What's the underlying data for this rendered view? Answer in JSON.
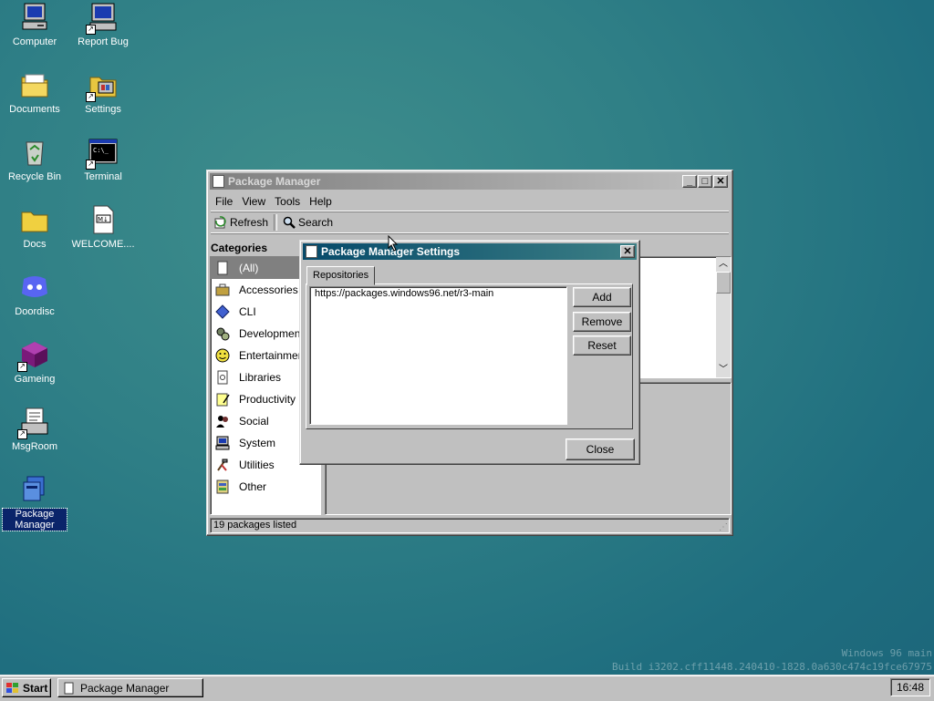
{
  "desktop": {
    "icons": [
      {
        "label": "Computer"
      },
      {
        "label": "Report Bug"
      },
      {
        "label": "Documents"
      },
      {
        "label": "Settings"
      },
      {
        "label": "Recycle Bin"
      },
      {
        "label": "Terminal"
      },
      {
        "label": "Docs"
      },
      {
        "label": "WELCOME...."
      },
      {
        "label": "Doordisc"
      },
      {
        "label": "Gameing"
      },
      {
        "label": "MsgRoom"
      },
      {
        "label": "Package Manager"
      }
    ],
    "watermark": {
      "line1": "Windows 96 main",
      "line2": "Build i3202.cff11448.240410-1828.0a630c474c19fce67975"
    }
  },
  "package_manager": {
    "title": "Package Manager",
    "menu": [
      "File",
      "View",
      "Tools",
      "Help"
    ],
    "toolbar": {
      "refresh": "Refresh",
      "search": "Search"
    },
    "categories_header": "Categories",
    "categories": [
      {
        "label": "(All)",
        "icon": "all-icon"
      },
      {
        "label": "Accessories",
        "icon": "toolbox-icon"
      },
      {
        "label": "CLI",
        "icon": "diamond-icon"
      },
      {
        "label": "Development",
        "icon": "gears-icon"
      },
      {
        "label": "Entertainment",
        "icon": "smiley-icon"
      },
      {
        "label": "Libraries",
        "icon": "book-icon"
      },
      {
        "label": "Productivity",
        "icon": "notepad-icon"
      },
      {
        "label": "Social",
        "icon": "people-icon"
      },
      {
        "label": "System",
        "icon": "computer-icon"
      },
      {
        "label": "Utilities",
        "icon": "tools-icon"
      },
      {
        "label": "Other",
        "icon": "misc-icon"
      }
    ],
    "status": "19 packages listed"
  },
  "settings_dialog": {
    "title": "Package Manager Settings",
    "tab": "Repositories",
    "repositories": [
      "https://packages.windows96.net/r3-main"
    ],
    "buttons": {
      "add": "Add",
      "remove": "Remove",
      "reset": "Reset",
      "close": "Close"
    }
  },
  "taskbar": {
    "start": "Start",
    "task": "Package Manager",
    "clock": "16:48"
  }
}
